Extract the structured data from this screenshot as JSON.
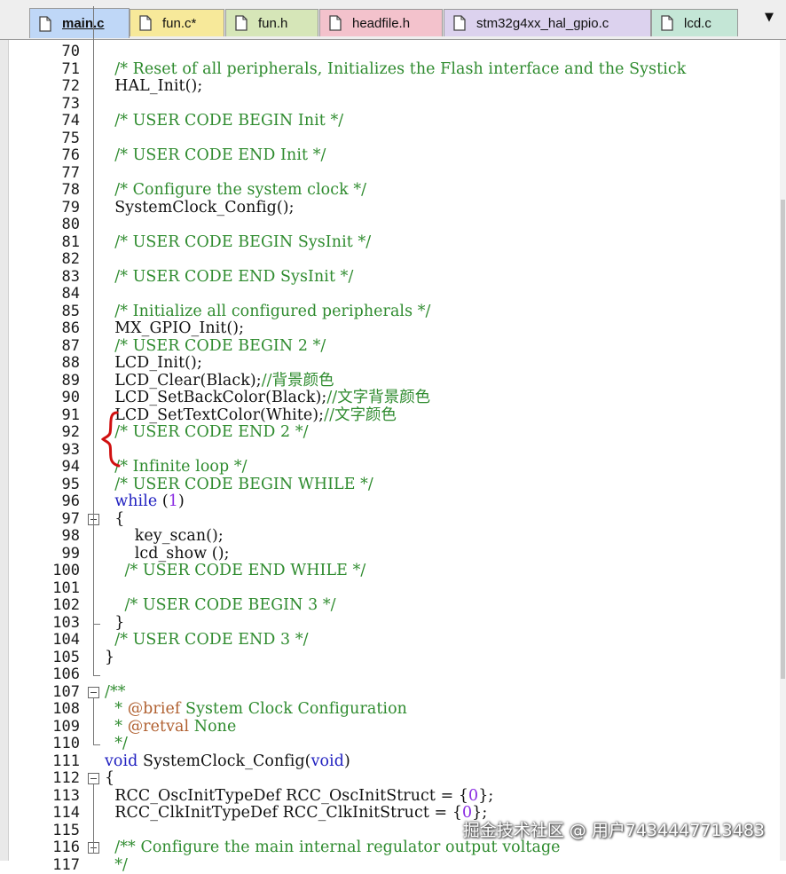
{
  "tabs": [
    {
      "label": "main.c",
      "color": "#bfd7f7",
      "active": true
    },
    {
      "label": "fun.c*",
      "color": "#f7e99a",
      "active": false
    },
    {
      "label": "fun.h",
      "color": "#d6e6b8",
      "active": false
    },
    {
      "label": "headfile.h",
      "color": "#f3c2cc",
      "active": false
    },
    {
      "label": "stm32g4xx_hal_gpio.c",
      "color": "#dcd2ee",
      "active": false
    },
    {
      "label": "lcd.c",
      "color": "#c4e6d6",
      "active": false
    }
  ],
  "tab_dropdown_icon": "dropdown-arrow-icon",
  "colors": {
    "comment": "#2e8b2e",
    "keyword": "#2020c0",
    "number": "#8a2be2",
    "annotation": "#c11b1b"
  },
  "lines": [
    {
      "n": "70",
      "t": ""
    },
    {
      "n": "71",
      "t": "  /* Reset of all peripherals, Initializes the Flash interface and the Systick"
    },
    {
      "n": "72",
      "t": "  HAL_Init();"
    },
    {
      "n": "73",
      "t": ""
    },
    {
      "n": "74",
      "t": "  /* USER CODE BEGIN Init */"
    },
    {
      "n": "75",
      "t": ""
    },
    {
      "n": "76",
      "t": "  /* USER CODE END Init */"
    },
    {
      "n": "77",
      "t": ""
    },
    {
      "n": "78",
      "t": "  /* Configure the system clock */"
    },
    {
      "n": "79",
      "t": "  SystemClock_Config();"
    },
    {
      "n": "80",
      "t": ""
    },
    {
      "n": "81",
      "t": "  /* USER CODE BEGIN SysInit */"
    },
    {
      "n": "82",
      "t": ""
    },
    {
      "n": "83",
      "t": "  /* USER CODE END SysInit */"
    },
    {
      "n": "84",
      "t": ""
    },
    {
      "n": "85",
      "t": "  /* Initialize all configured peripherals */"
    },
    {
      "n": "86",
      "t": "  MX_GPIO_Init();"
    },
    {
      "n": "87",
      "t": "  /* USER CODE BEGIN 2 */"
    },
    {
      "n": "88",
      "t": "  LCD_Init();"
    },
    {
      "n": "89",
      "t": "  LCD_Clear(Black);//背景颜色"
    },
    {
      "n": "90",
      "t": "  LCD_SetBackColor(Black);//文字背景颜色"
    },
    {
      "n": "91",
      "t": "  LCD_SetTextColor(White);//文字颜色"
    },
    {
      "n": "92",
      "t": "  /* USER CODE END 2 */"
    },
    {
      "n": "93",
      "t": ""
    },
    {
      "n": "94",
      "t": "  /* Infinite loop */"
    },
    {
      "n": "95",
      "t": "  /* USER CODE BEGIN WHILE */"
    },
    {
      "n": "96",
      "t": "  while (1)"
    },
    {
      "n": "97",
      "t": "  {"
    },
    {
      "n": "98",
      "t": "      key_scan();"
    },
    {
      "n": "99",
      "t": "      lcd_show ();"
    },
    {
      "n": "100",
      "t": "    /* USER CODE END WHILE */"
    },
    {
      "n": "101",
      "t": ""
    },
    {
      "n": "102",
      "t": "    /* USER CODE BEGIN 3 */"
    },
    {
      "n": "103",
      "t": "  }"
    },
    {
      "n": "104",
      "t": "  /* USER CODE END 3 */"
    },
    {
      "n": "105",
      "t": "}"
    },
    {
      "n": "106",
      "t": ""
    },
    {
      "n": "107",
      "t": "/**"
    },
    {
      "n": "108",
      "t": "  * @brief System Clock Configuration"
    },
    {
      "n": "109",
      "t": "  * @retval None"
    },
    {
      "n": "110",
      "t": "  */"
    },
    {
      "n": "111",
      "t": "void SystemClock_Config(void)"
    },
    {
      "n": "112",
      "t": "{"
    },
    {
      "n": "113",
      "t": "  RCC_OscInitTypeDef RCC_OscInitStruct = {0};"
    },
    {
      "n": "114",
      "t": "  RCC_ClkInitTypeDef RCC_ClkInitStruct = {0};"
    },
    {
      "n": "115",
      "t": ""
    },
    {
      "n": "116",
      "t": "  /** Configure the main internal regulator output voltage"
    },
    {
      "n": "117",
      "t": "  */"
    }
  ],
  "watermark": "掘金技术社区 @ 用户7434447713483"
}
